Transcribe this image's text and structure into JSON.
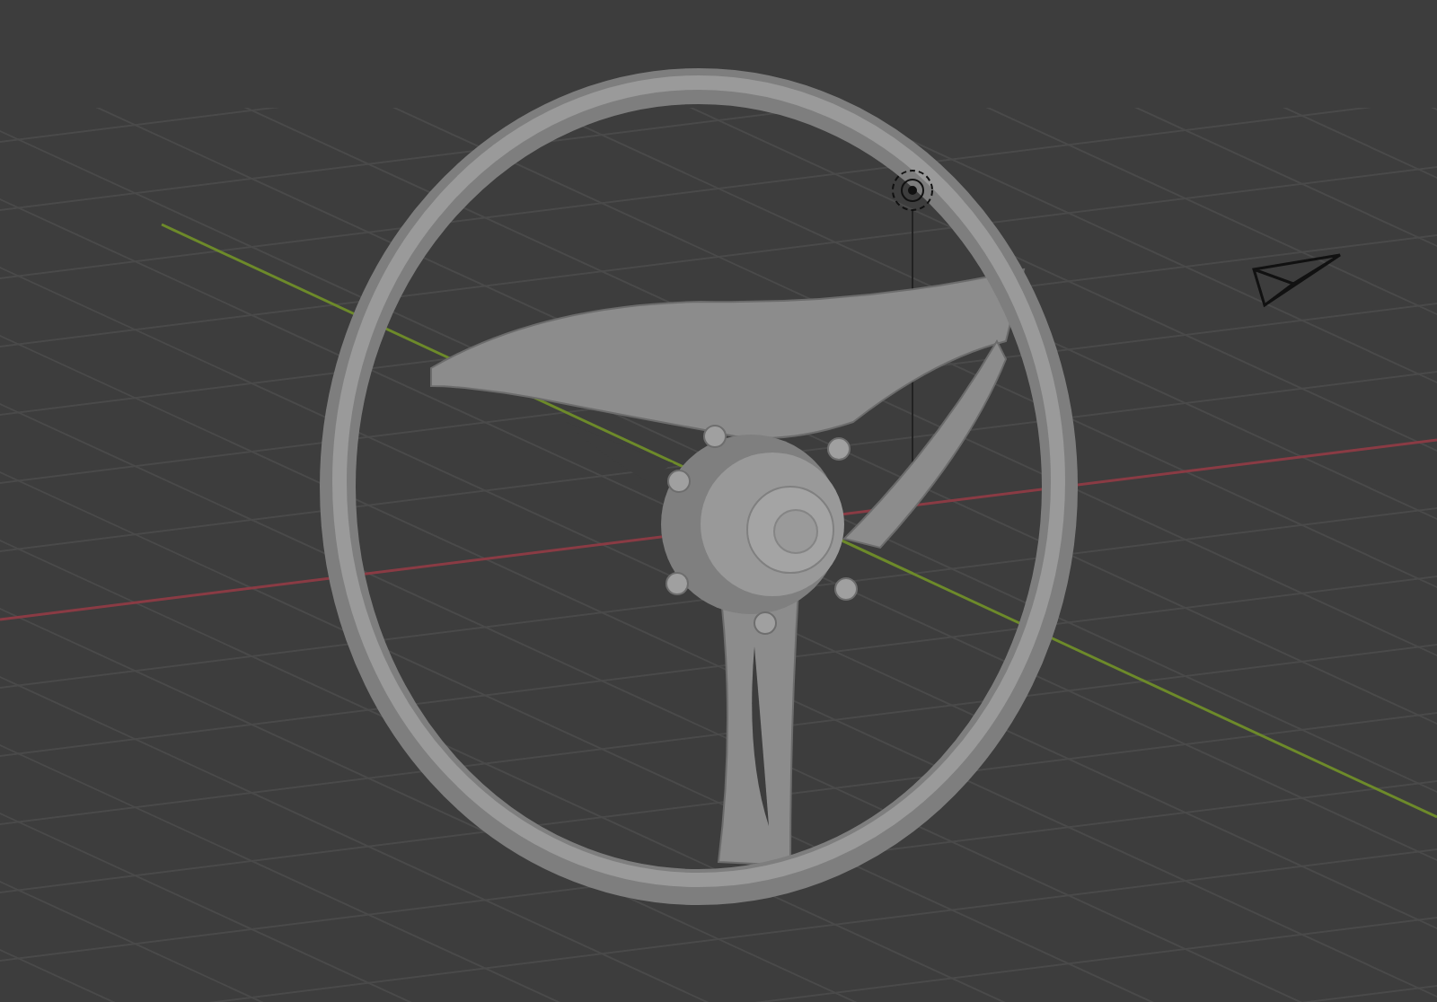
{
  "viewport": {
    "objects": [
      {
        "kind": "steering-wheel"
      },
      {
        "kind": "light"
      },
      {
        "kind": "camera"
      }
    ]
  }
}
